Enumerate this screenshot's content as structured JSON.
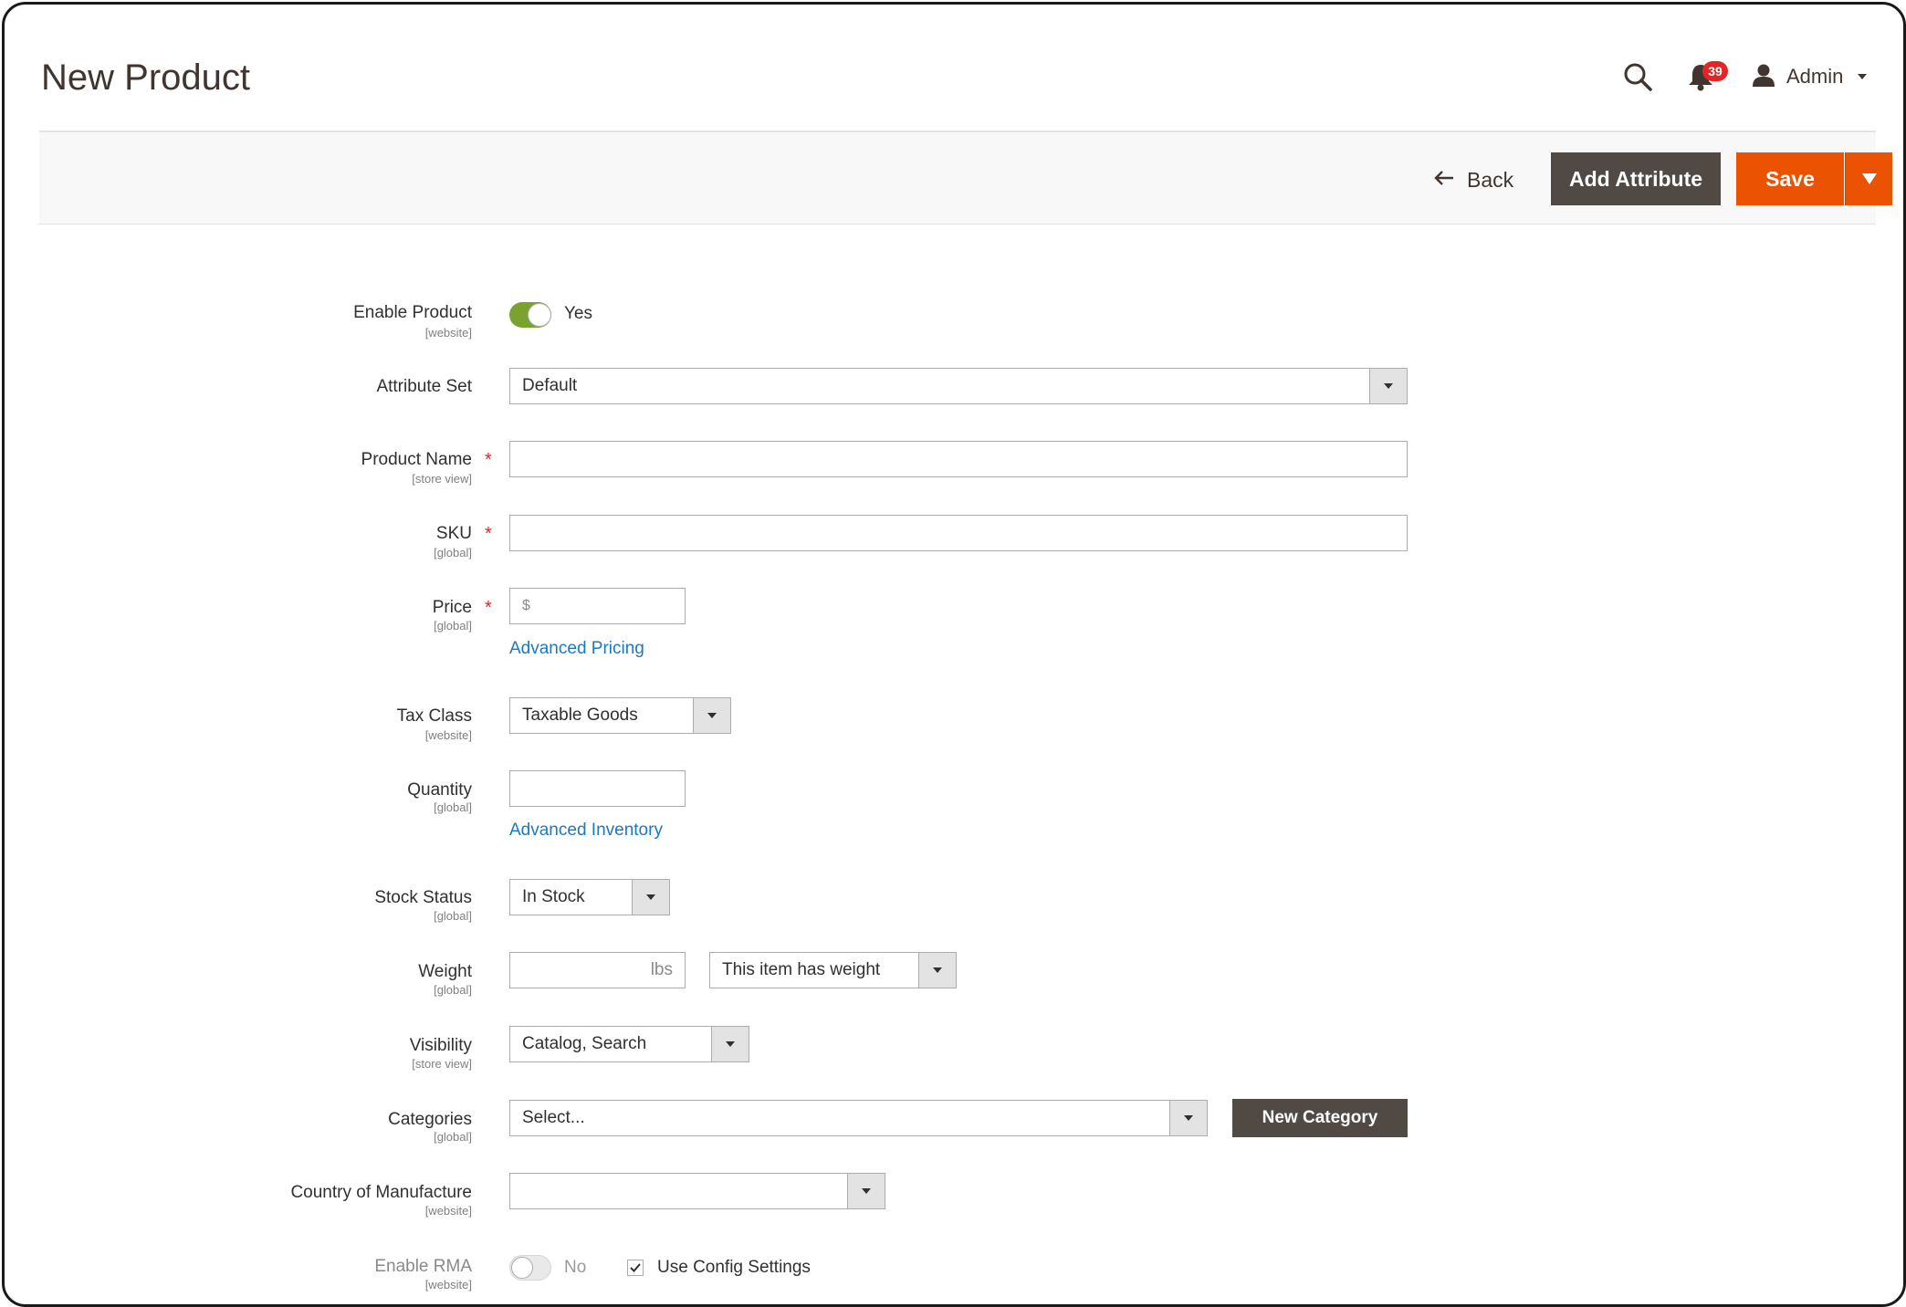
{
  "header": {
    "title": "New Product",
    "notifications_count": "39",
    "user_name": "Admin"
  },
  "action_bar": {
    "back_label": "Back",
    "add_attribute_label": "Add Attribute",
    "save_label": "Save"
  },
  "form": {
    "enable_product": {
      "label": "Enable Product",
      "scope": "[website]",
      "value": "Yes"
    },
    "attribute_set": {
      "label": "Attribute Set",
      "value": "Default"
    },
    "product_name": {
      "label": "Product Name",
      "scope": "[store view]",
      "value": ""
    },
    "sku": {
      "label": "SKU",
      "scope": "[global]",
      "value": ""
    },
    "price": {
      "label": "Price",
      "scope": "[global]",
      "placeholder": "$",
      "link": "Advanced Pricing"
    },
    "tax_class": {
      "label": "Tax Class",
      "scope": "[website]",
      "value": "Taxable Goods"
    },
    "quantity": {
      "label": "Quantity",
      "scope": "[global]",
      "value": "",
      "link": "Advanced Inventory"
    },
    "stock_status": {
      "label": "Stock Status",
      "scope": "[global]",
      "value": "In Stock"
    },
    "weight": {
      "label": "Weight",
      "scope": "[global]",
      "unit": "lbs",
      "type_value": "This item has weight"
    },
    "visibility": {
      "label": "Visibility",
      "scope": "[store view]",
      "value": "Catalog, Search"
    },
    "categories": {
      "label": "Categories",
      "scope": "[global]",
      "value": "Select...",
      "new_label": "New Category"
    },
    "country": {
      "label": "Country of Manufacture",
      "scope": "[website]",
      "value": ""
    },
    "enable_rma": {
      "label": "Enable RMA",
      "scope": "[website]",
      "value": "No",
      "config_label": "Use Config Settings"
    }
  },
  "colors": {
    "accent": "#eb5202",
    "dark_button": "#514943",
    "link": "#1979c3",
    "toggle_on": "#79a22e",
    "required": "#e22626"
  }
}
